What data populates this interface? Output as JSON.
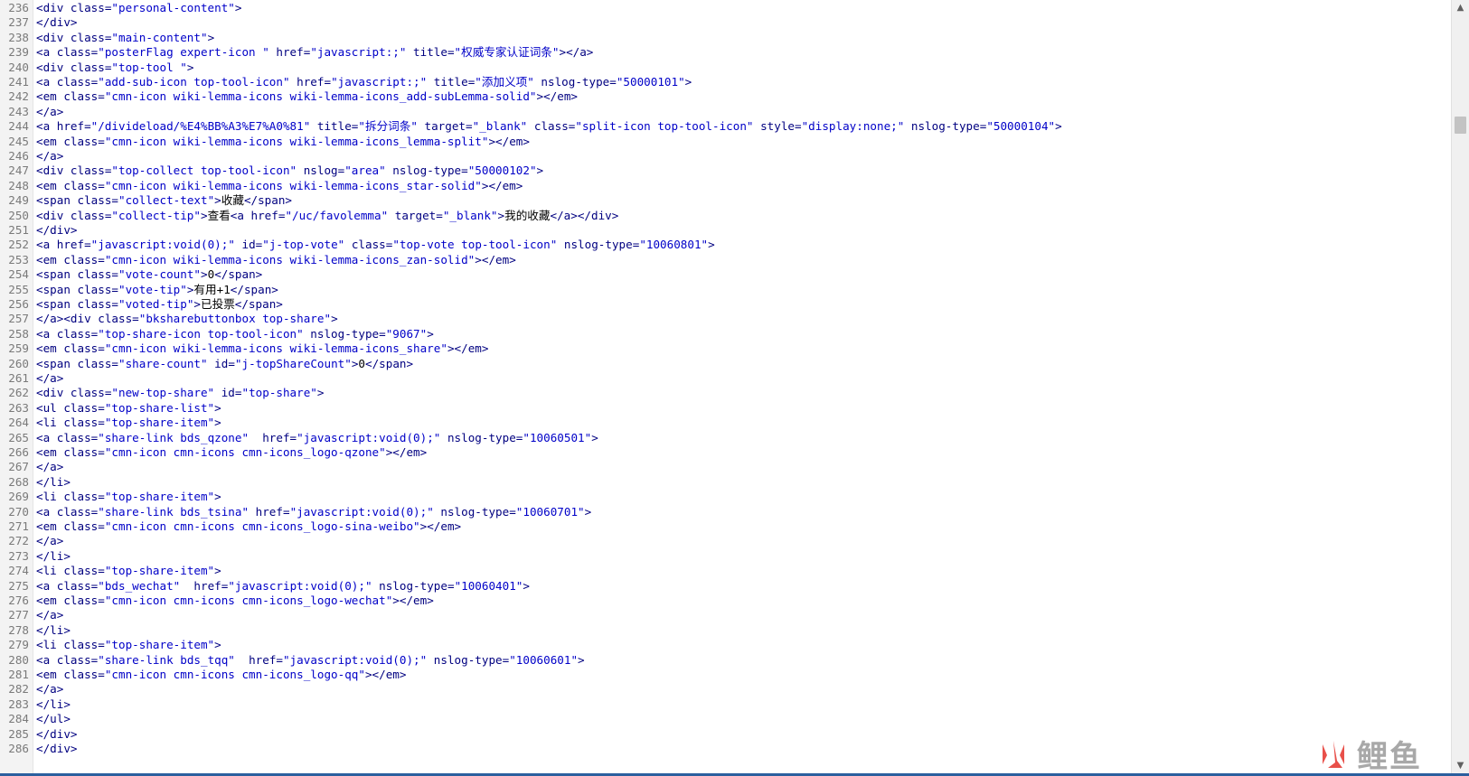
{
  "lines": [
    {
      "n": "236",
      "t": "<div class=\"personal-content\">"
    },
    {
      "n": "237",
      "t": "</div>"
    },
    {
      "n": "238",
      "t": "<div class=\"main-content\">"
    },
    {
      "n": "239",
      "t": "<a class=\"posterFlag expert-icon \" href=\"javascript:;\" title=\"权威专家认证词条\"></a>"
    },
    {
      "n": "240",
      "t": "<div class=\"top-tool \">"
    },
    {
      "n": "241",
      "t": "<a class=\"add-sub-icon top-tool-icon\" href=\"javascript:;\" title=\"添加义项\" nslog-type=\"50000101\">"
    },
    {
      "n": "242",
      "t": "<em class=\"cmn-icon wiki-lemma-icons wiki-lemma-icons_add-subLemma-solid\"></em>"
    },
    {
      "n": "243",
      "t": "</a>"
    },
    {
      "n": "244",
      "t": "<a href=\"/divideload/%E4%BB%A3%E7%A0%81\" title=\"拆分词条\" target=\"_blank\" class=\"split-icon top-tool-icon\" style=\"display:none;\" nslog-type=\"50000104\">"
    },
    {
      "n": "245",
      "t": "<em class=\"cmn-icon wiki-lemma-icons wiki-lemma-icons_lemma-split\"></em>"
    },
    {
      "n": "246",
      "t": "</a>"
    },
    {
      "n": "247",
      "t": "<div class=\"top-collect top-tool-icon\" nslog=\"area\" nslog-type=\"50000102\">"
    },
    {
      "n": "248",
      "t": "<em class=\"cmn-icon wiki-lemma-icons wiki-lemma-icons_star-solid\"></em>"
    },
    {
      "n": "249",
      "t": "<span class=\"collect-text\">收藏</span>"
    },
    {
      "n": "250",
      "t": "<div class=\"collect-tip\">查看<a href=\"/uc/favolemma\" target=\"_blank\">我的收藏</a></div>"
    },
    {
      "n": "251",
      "t": "</div>"
    },
    {
      "n": "252",
      "t": "<a href=\"javascript:void(0);\" id=\"j-top-vote\" class=\"top-vote top-tool-icon\" nslog-type=\"10060801\">"
    },
    {
      "n": "253",
      "t": "<em class=\"cmn-icon wiki-lemma-icons wiki-lemma-icons_zan-solid\"></em>"
    },
    {
      "n": "254",
      "t": "<span class=\"vote-count\">0</span>"
    },
    {
      "n": "255",
      "t": "<span class=\"vote-tip\">有用+1</span>"
    },
    {
      "n": "256",
      "t": "<span class=\"voted-tip\">已投票</span>"
    },
    {
      "n": "257",
      "t": "</a><div class=\"bksharebuttonbox top-share\">"
    },
    {
      "n": "258",
      "t": "<a class=\"top-share-icon top-tool-icon\" nslog-type=\"9067\">"
    },
    {
      "n": "259",
      "t": "<em class=\"cmn-icon wiki-lemma-icons wiki-lemma-icons_share\"></em>"
    },
    {
      "n": "260",
      "t": "<span class=\"share-count\" id=\"j-topShareCount\">0</span>"
    },
    {
      "n": "261",
      "t": "</a>"
    },
    {
      "n": "262",
      "t": "<div class=\"new-top-share\" id=\"top-share\">"
    },
    {
      "n": "263",
      "t": "<ul class=\"top-share-list\">"
    },
    {
      "n": "264",
      "t": "<li class=\"top-share-item\">"
    },
    {
      "n": "265",
      "t": "<a class=\"share-link bds_qzone\"  href=\"javascript:void(0);\" nslog-type=\"10060501\">"
    },
    {
      "n": "266",
      "t": "<em class=\"cmn-icon cmn-icons cmn-icons_logo-qzone\"></em>"
    },
    {
      "n": "267",
      "t": "</a>"
    },
    {
      "n": "268",
      "t": "</li>"
    },
    {
      "n": "269",
      "t": "<li class=\"top-share-item\">"
    },
    {
      "n": "270",
      "t": "<a class=\"share-link bds_tsina\" href=\"javascript:void(0);\" nslog-type=\"10060701\">"
    },
    {
      "n": "271",
      "t": "<em class=\"cmn-icon cmn-icons cmn-icons_logo-sina-weibo\"></em>"
    },
    {
      "n": "272",
      "t": "</a>"
    },
    {
      "n": "273",
      "t": "</li>"
    },
    {
      "n": "274",
      "t": "<li class=\"top-share-item\">"
    },
    {
      "n": "275",
      "t": "<a class=\"bds_wechat\"  href=\"javascript:void(0);\" nslog-type=\"10060401\">"
    },
    {
      "n": "276",
      "t": "<em class=\"cmn-icon cmn-icons cmn-icons_logo-wechat\"></em>"
    },
    {
      "n": "277",
      "t": "</a>"
    },
    {
      "n": "278",
      "t": "</li>"
    },
    {
      "n": "279",
      "t": "<li class=\"top-share-item\">"
    },
    {
      "n": "280",
      "t": "<a class=\"share-link bds_tqq\"  href=\"javascript:void(0);\" nslog-type=\"10060601\">"
    },
    {
      "n": "281",
      "t": "<em class=\"cmn-icon cmn-icons cmn-icons_logo-qq\"></em>"
    },
    {
      "n": "282",
      "t": "</a>"
    },
    {
      "n": "283",
      "t": "</li>"
    },
    {
      "n": "284",
      "t": "</ul>"
    },
    {
      "n": "285",
      "t": "</div>"
    },
    {
      "n": "286",
      "t": "</div>"
    }
  ],
  "watermark": {
    "text": "鲤鱼",
    "brand_color": "#e8504a"
  },
  "scrollbar": {
    "position_fraction": 0.14
  },
  "colors": {
    "tag": "#000080",
    "value": "#0000c8",
    "text": "#000000",
    "line_number": "#7a7a7a"
  },
  "icons": {
    "scroll_up": "triangle-up",
    "scroll_down": "triangle-down",
    "watermark_logo": "fire-logo"
  }
}
